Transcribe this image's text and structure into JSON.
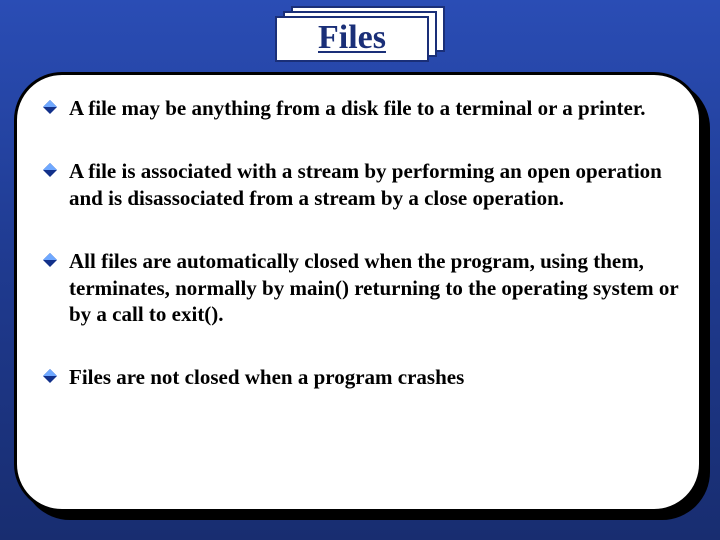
{
  "title": "Files",
  "bullet_icon_name": "diamond-bullet-icon",
  "bullet_colors": {
    "top": "#6fa8ff",
    "bottom": "#12308a"
  },
  "bullets": [
    "A file may be anything from a disk file to a terminal or a printer.",
    "A file is associated with a stream by performing an open operation and is disassociated from a stream by a close operation.",
    "All files are automatically closed when the program, using them, terminates, normally by main() returning to the operating system or by a call to exit().",
    "Files are not closed when a program crashes"
  ]
}
